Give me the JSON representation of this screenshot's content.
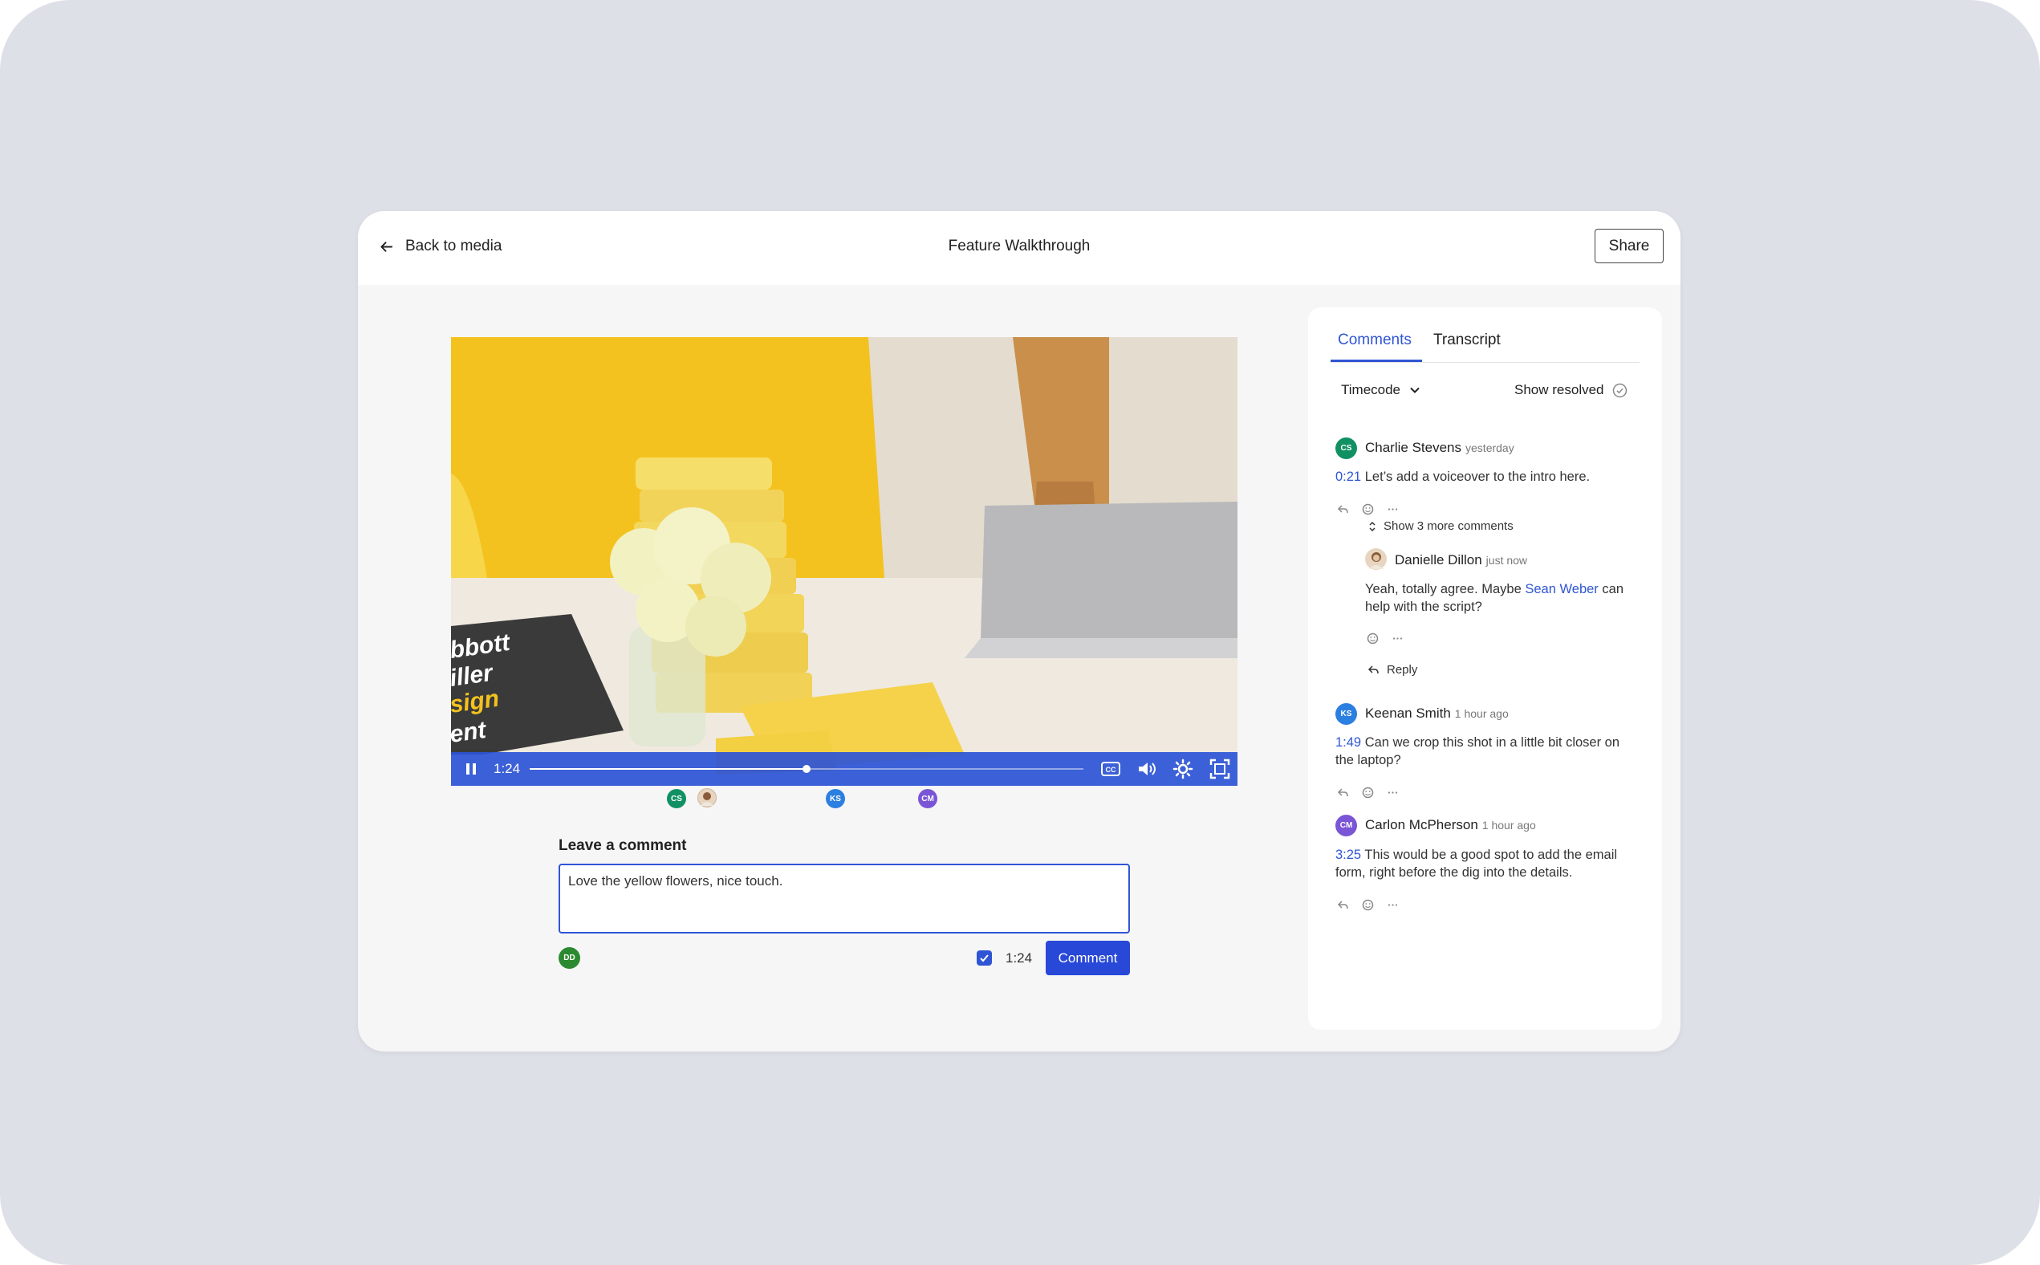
{
  "topbar": {
    "back_label": "Back to media",
    "title": "Feature Walkthrough",
    "share_label": "Share"
  },
  "player": {
    "current_time": "1:24",
    "progress": 0.5,
    "icons": [
      "pause-icon",
      "closed-captions-icon",
      "volume-icon",
      "settings-icon",
      "fullscreen-icon"
    ]
  },
  "timeline_markers": [
    {
      "initials": "CS",
      "color": "#119163"
    },
    {
      "initials": "",
      "color": "#c9a27a"
    },
    {
      "initials": "KS",
      "color": "#2b7fe0"
    },
    {
      "initials": "CM",
      "color": "#7a55d6"
    }
  ],
  "composer": {
    "heading": "Leave a comment",
    "value": "Love the yellow flowers, nice touch.",
    "author_initials": "DD",
    "timecode": "1:24",
    "submit_label": "Comment"
  },
  "panel": {
    "tabs": [
      "Comments",
      "Transcript"
    ],
    "filter_label": "Timecode",
    "show_resolved_label": "Show resolved",
    "show_more_label": "Show 3 more comments",
    "reply_label": "Reply",
    "comments": [
      {
        "initials": "CS",
        "name": "Charlie Stevens",
        "time": "yesterday",
        "timecode": "0:21",
        "text": "Let’s add a voiceover to the intro here."
      },
      {
        "initials": "KS",
        "name": "Keenan Smith",
        "time": "1 hour ago",
        "timecode": "1:49",
        "text": "Can we crop this shot in a little bit closer on the laptop?"
      },
      {
        "initials": "CM",
        "name": "Carlon McPherson",
        "time": "1 hour ago",
        "timecode": "3:25",
        "text": "This would be a good spot to add the email form, right before the dig into the details."
      }
    ],
    "reply_comment": {
      "name": "Danielle Dillon",
      "time": "just now",
      "text_before": "Yeah, totally agree. Maybe",
      "mention": "Sean Weber",
      "text_after": "can help with the script?"
    }
  },
  "colors": {
    "accent": "#2f55d4",
    "button": "#2848d8",
    "outer_background": "#dee0e7"
  }
}
